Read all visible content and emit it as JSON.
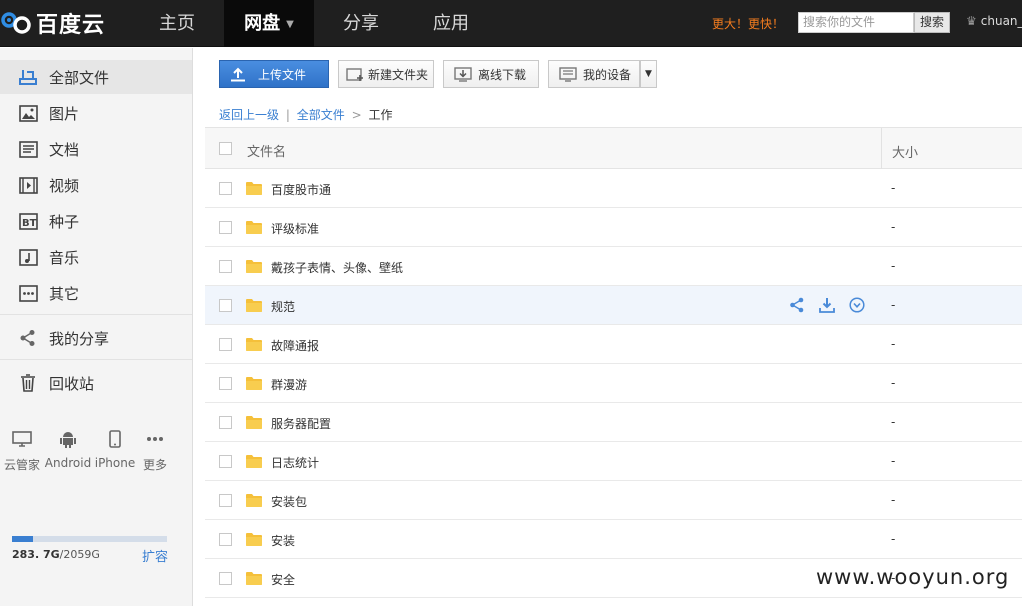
{
  "brand": {
    "logo_text": "百度云"
  },
  "nav": {
    "items": [
      {
        "label": "主页"
      },
      {
        "label": "网盘"
      },
      {
        "label": "分享"
      },
      {
        "label": "应用"
      }
    ],
    "promo": "更大！更快！",
    "search_placeholder": "搜索你的文件",
    "search_button": "搜索",
    "user": "chuan_"
  },
  "sidebar": {
    "items": [
      {
        "label": "全部文件",
        "icon": "all-files-icon"
      },
      {
        "label": "图片",
        "icon": "image-icon"
      },
      {
        "label": "文档",
        "icon": "document-icon"
      },
      {
        "label": "视频",
        "icon": "video-icon"
      },
      {
        "label": "种子",
        "icon": "bt-torrent-icon"
      },
      {
        "label": "音乐",
        "icon": "music-icon"
      },
      {
        "label": "其它",
        "icon": "other-icon"
      },
      {
        "label": "我的分享",
        "icon": "share-icon"
      },
      {
        "label": "回收站",
        "icon": "trash-icon"
      }
    ],
    "devices": [
      {
        "label": "云管家",
        "icon": "desktop-icon"
      },
      {
        "label": "Android",
        "icon": "android-icon"
      },
      {
        "label": "iPhone",
        "icon": "iphone-icon"
      },
      {
        "label": "更多",
        "icon": "more-icon"
      }
    ],
    "quota": {
      "used": "283. 7G",
      "total": "/2059G",
      "expand": "扩容",
      "used_fraction": 0.138
    }
  },
  "toolbar": {
    "upload": "上传文件",
    "new_folder": "新建文件夹",
    "offline_download": "离线下载",
    "my_devices": "我的设备"
  },
  "breadcrumb": {
    "back": "返回上一级",
    "divider": "|",
    "root": "全部文件",
    "arrow": ">",
    "current": "工作"
  },
  "table": {
    "col_name": "文件名",
    "col_size": "大小",
    "rows": [
      {
        "name": "百度股市通",
        "size": "-"
      },
      {
        "name": "评级标准",
        "size": "-"
      },
      {
        "name": "戴孩子表情、头像、壁纸",
        "size": "-"
      },
      {
        "name": "规范",
        "size": "-"
      },
      {
        "name": "故障通报",
        "size": "-"
      },
      {
        "name": "群漫游",
        "size": "-"
      },
      {
        "name": "服务器配置",
        "size": "-"
      },
      {
        "name": "日志统计",
        "size": "-"
      },
      {
        "name": "安装包",
        "size": "-"
      },
      {
        "name": "安装",
        "size": "-"
      },
      {
        "name": "安全",
        "size": "-"
      }
    ]
  },
  "watermark": "www.wooyun.org",
  "colors": {
    "accent": "#3a7fd1",
    "topbar": "#1f1f1f",
    "promo": "#f57d1f",
    "folder": "#f5c03a"
  }
}
